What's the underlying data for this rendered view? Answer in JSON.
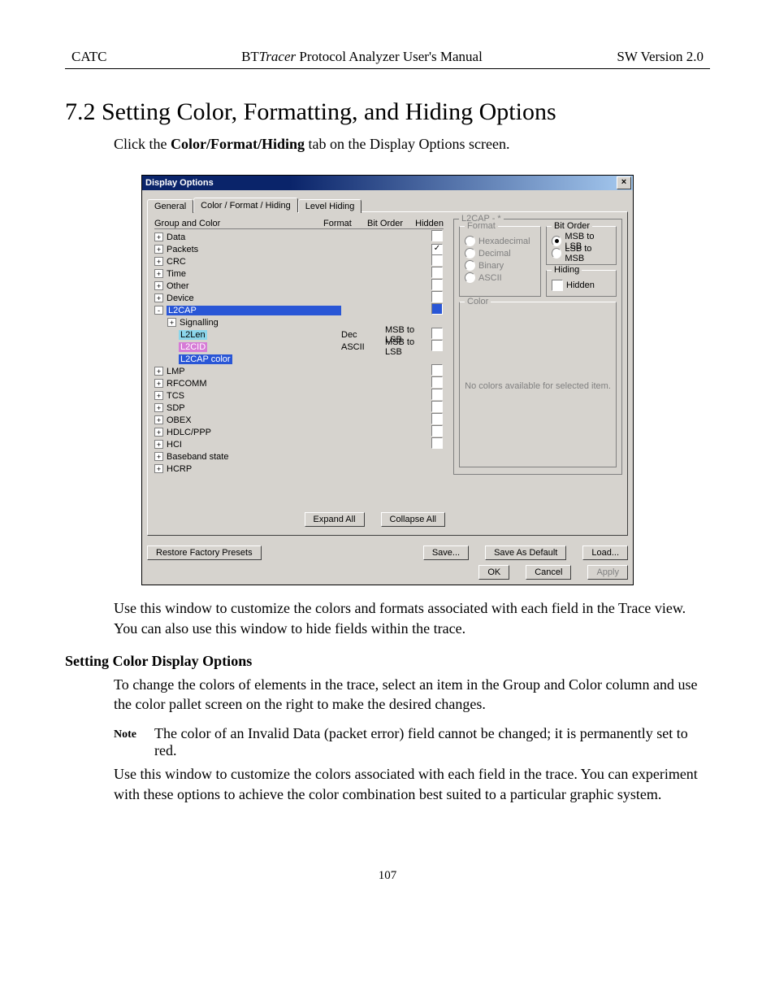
{
  "header": {
    "left": "CATC",
    "mid_pre": "BT",
    "mid_it": "Tracer",
    "mid_post": " Protocol Analyzer User's Manual",
    "right": "SW Version 2.0"
  },
  "heading": "7.2  Setting Color, Formatting, and Hiding Options",
  "intro_pre": "Click the ",
  "intro_bold": "Color/Format/Hiding",
  "intro_post": " tab on the Display Options screen.",
  "dialog": {
    "title": "Display Options",
    "close": "×",
    "tabs": {
      "general": "General",
      "cfh": "Color / Format / Hiding",
      "level": "Level Hiding"
    },
    "headers": {
      "group": "Group and Color",
      "format": "Format",
      "bitorder": "Bit Order",
      "hidden": "Hidden"
    },
    "tree": {
      "data": "Data",
      "packets": "Packets",
      "crc": "CRC",
      "time": "Time",
      "other": "Other",
      "device": "Device",
      "l2cap": "L2CAP",
      "signalling": "Signalling",
      "l2len": "L2Len",
      "l2len_fmt": "Dec",
      "l2len_bit": "MSB to LSB",
      "l2cid": "L2CID",
      "l2cid_fmt": "ASCII",
      "l2cid_bit": "MSB to LSB",
      "l2color": "L2CAP color",
      "lmp": "LMP",
      "rfcomm": "RFCOMM",
      "tcs": "TCS",
      "sdp": "SDP",
      "obex": "OBEX",
      "hdlc": "HDLC/PPP",
      "hci": "HCI",
      "baseband": "Baseband state",
      "hcrp": "HCRP"
    },
    "buttons": {
      "expand": "Expand All",
      "collapse": "Collapse All",
      "restore": "Restore Factory Presets",
      "save": "Save...",
      "saveas": "Save As Default",
      "load": "Load...",
      "ok": "OK",
      "cancel": "Cancel",
      "apply": "Apply"
    },
    "right": {
      "group_title": "L2CAP - *",
      "format_title": "Format",
      "fmt_hex": "Hexadecimal",
      "fmt_dec": "Decimal",
      "fmt_bin": "Binary",
      "fmt_ascii": "ASCII",
      "bit_title": "Bit Order",
      "bit_msb": "MSB to LSB",
      "bit_lsb": "LSB to MSB",
      "hiding_title": "Hiding",
      "hidden_chk": "Hidden",
      "color_title": "Color",
      "no_colors": "No colors available for selected item."
    }
  },
  "para1": "Use this window to customize the colors and formats associated with each field in the Trace view. You can also use this window to hide fields within the trace.",
  "subhead": "Setting Color Display Options",
  "para2": "To change the colors of elements in the trace, select an item in the Group and Color column and use the color pallet screen on the right to make the desired changes.",
  "note_label": "Note",
  "note_text": "The color of an Invalid Data (packet error) field cannot be changed; it is permanently set to red.",
  "para3": "Use this window to customize the colors associated with each field in the trace.  You can experiment with these options to achieve the color combination best suited to a particular graphic system.",
  "page_number": "107"
}
